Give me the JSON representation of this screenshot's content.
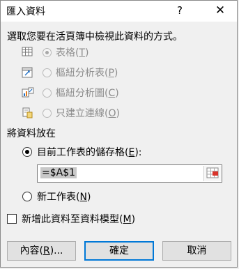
{
  "dialog": {
    "title": "匯入資料",
    "help_label": "?",
    "close_label": "✕",
    "prompt": "選取您要在活頁簿中檢視此資料的方式。"
  },
  "view_options": [
    {
      "icon": "table-icon",
      "label_pre": "表格(",
      "hotkey": "T",
      "label_post": ")",
      "selected": true,
      "enabled": false
    },
    {
      "icon": "pivot-table-icon",
      "label_pre": "樞紐分析表(",
      "hotkey": "P",
      "label_post": ")",
      "selected": false,
      "enabled": false
    },
    {
      "icon": "pivot-chart-icon",
      "label_pre": "樞紐分析圖(",
      "hotkey": "C",
      "label_post": ")",
      "selected": false,
      "enabled": false
    },
    {
      "icon": "connection-icon",
      "label_pre": "只建立連線(",
      "hotkey": "O",
      "label_post": ")",
      "selected": false,
      "enabled": false
    }
  ],
  "placement": {
    "section_label": "將資料放在",
    "existing_sheet_pre": "目前工作表的儲存格(",
    "existing_sheet_hotkey": "E",
    "existing_sheet_post": "):",
    "cell_reference": "=$A$1",
    "new_sheet_pre": "新工作表(",
    "new_sheet_hotkey": "N",
    "new_sheet_post": ")",
    "selected": "existing"
  },
  "data_model": {
    "label_pre": "新增此資料至資料模型(",
    "hotkey": "M",
    "label_post": ")",
    "checked": false
  },
  "buttons": {
    "properties_pre": "內容(",
    "properties_hotkey": "R",
    "properties_post": ")...",
    "ok": "確定",
    "cancel": "取消"
  },
  "colors": {
    "accent": "#0078d7",
    "disabled_text": "#8c8c8c"
  }
}
